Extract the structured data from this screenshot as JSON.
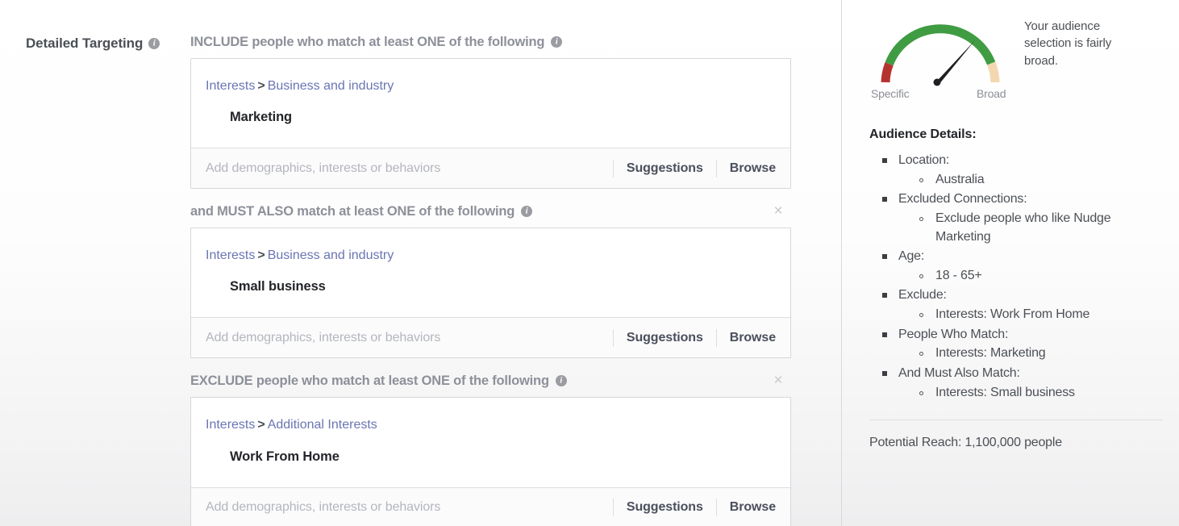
{
  "field": {
    "label": "Detailed Targeting",
    "info_icon": "info-icon"
  },
  "groups": [
    {
      "id": "include",
      "header": "INCLUDE people who match at least ONE of the following",
      "has_close": false,
      "breadcrumb": {
        "root": "Interests",
        "separator": ">",
        "category": "Business and industry"
      },
      "selection": "Marketing",
      "input_placeholder": "Add demographics, interests or behaviors",
      "suggestions_label": "Suggestions",
      "browse_label": "Browse"
    },
    {
      "id": "must-also",
      "header": "and MUST ALSO match at least ONE of the following",
      "has_close": true,
      "close_label": "×",
      "breadcrumb": {
        "root": "Interests",
        "separator": ">",
        "category": "Business and industry"
      },
      "selection": "Small business",
      "input_placeholder": "Add demographics, interests or behaviors",
      "suggestions_label": "Suggestions",
      "browse_label": "Browse"
    },
    {
      "id": "exclude",
      "header": "EXCLUDE people who match at least ONE of the following",
      "has_close": true,
      "close_label": "×",
      "breadcrumb": {
        "root": "Interests",
        "separator": ">",
        "category": "Additional Interests"
      },
      "selection": "Work From Home",
      "input_placeholder": "Add demographics, interests or behaviors",
      "suggestions_label": "Suggestions",
      "browse_label": "Browse"
    }
  ],
  "sidebar": {
    "gauge": {
      "left_label": "Specific",
      "right_label": "Broad",
      "message": "Your audience selection is fairly broad.",
      "needle_angle_deg": -42,
      "colors": {
        "low": "#b5332f",
        "mid": "#3f9c42",
        "high": "#f3d7b0"
      }
    },
    "details_title": "Audience Details:",
    "details": [
      {
        "label": "Location:",
        "items": [
          "Australia"
        ]
      },
      {
        "label": "Excluded Connections:",
        "items": [
          "Exclude people who like Nudge Marketing"
        ]
      },
      {
        "label": "Age:",
        "items": [
          "18 - 65+"
        ]
      },
      {
        "label": "Exclude:",
        "items": [
          "Interests: Work From Home"
        ]
      },
      {
        "label": "People Who Match:",
        "items": [
          "Interests: Marketing"
        ]
      },
      {
        "label": "And Must Also Match:",
        "items": [
          "Interests: Small business"
        ]
      }
    ],
    "potential_reach": "Potential Reach: 1,100,000 people"
  }
}
